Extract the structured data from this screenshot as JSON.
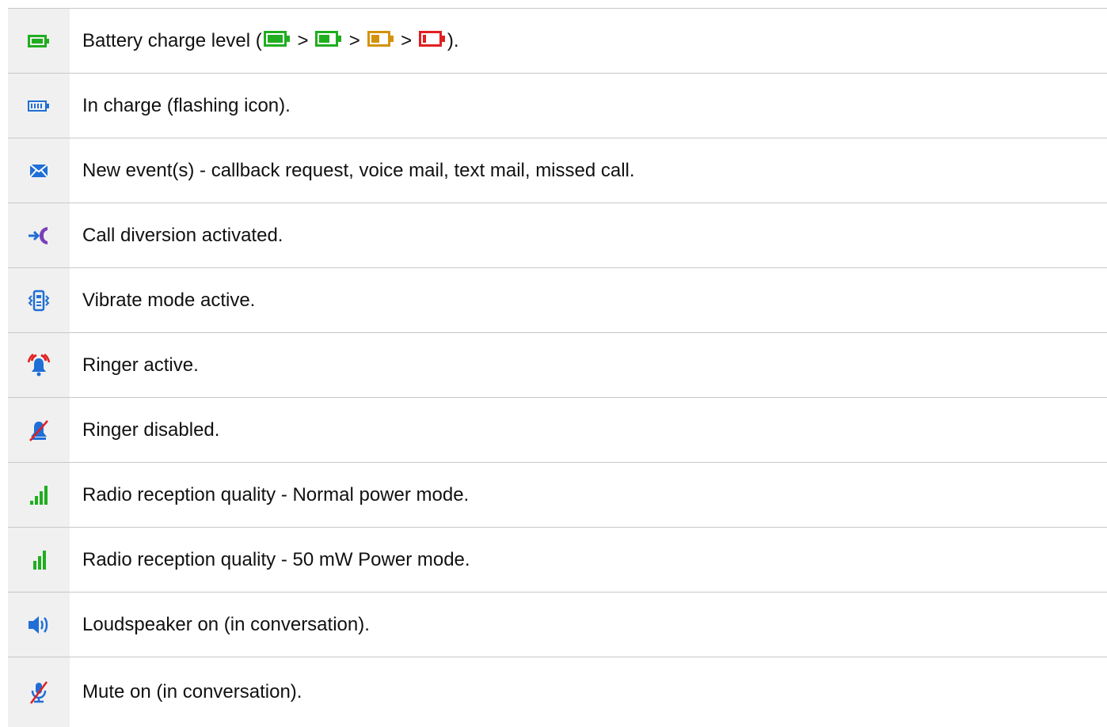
{
  "rows": [
    {
      "icon": "battery-full-icon",
      "text_prefix": "Battery charge level (",
      "sep": ">",
      "text_suffix": ").",
      "inline_levels": [
        {
          "name": "battery-full-icon",
          "color": "#1fae1f",
          "level": 0.8
        },
        {
          "name": "battery-medium-icon",
          "color": "#1fae1f",
          "level": 0.5
        },
        {
          "name": "battery-low-icon",
          "color": "#d4920c",
          "level": 0.4
        },
        {
          "name": "battery-empty-icon",
          "color": "#e02020",
          "level": 0.15
        }
      ]
    },
    {
      "icon": "battery-charging-icon",
      "text": "In charge (flashing icon)."
    },
    {
      "icon": "envelope-icon",
      "text": "New event(s) - callback request, voice mail, text mail, missed call."
    },
    {
      "icon": "call-diversion-icon",
      "text": "Call diversion activated."
    },
    {
      "icon": "vibrate-icon",
      "text": "Vibrate mode active."
    },
    {
      "icon": "ringer-bell-icon",
      "text": "Ringer active."
    },
    {
      "icon": "ringer-disabled-icon",
      "text": "Ringer disabled."
    },
    {
      "icon": "signal-normal-icon",
      "text": "Radio reception quality - Normal power mode."
    },
    {
      "icon": "signal-50mw-icon",
      "text": "Radio reception quality - 50 mW Power mode."
    },
    {
      "icon": "loudspeaker-icon",
      "text": "Loudspeaker on (in conversation)."
    },
    {
      "icon": "mute-microphone-icon",
      "text": "Mute on (in conversation)."
    }
  ],
  "colors": {
    "green": "#1fae1f",
    "blue": "#1f6fd6",
    "orange": "#d4920c",
    "red": "#e02020",
    "purple": "#7a3fb8"
  }
}
